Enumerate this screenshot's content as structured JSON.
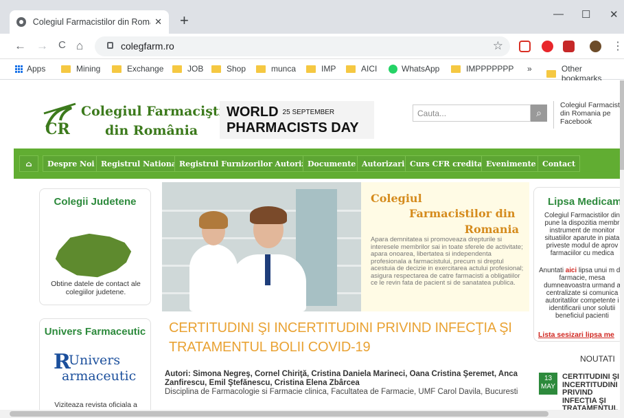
{
  "browser": {
    "tab_title": "Colegiul Farmacistilor din Romania",
    "tab_close": "✕",
    "new_tab": "+",
    "url": "colegfarm.ro",
    "controls": {
      "minimize": "—",
      "maximize": "☐",
      "close": "✕"
    },
    "nav": {
      "back": "←",
      "forward": "→",
      "reload": "C",
      "home": "⌂"
    },
    "menu": "⋮",
    "star": "☆",
    "bookmarks": [
      "Apps",
      "Mining",
      "Exchange",
      "JOB",
      "Shop",
      "munca",
      "IMP",
      "AICI",
      "WhatsApp",
      "IMPPPPPPP"
    ],
    "bookmarks_more": "»",
    "other_bookmarks": "Other bookmarks"
  },
  "header": {
    "logo_line1": "Colegiul Farmaciştilor",
    "logo_line2": "din România",
    "banner_title": "WORLD",
    "banner_date": "25 SEPTEMBER",
    "banner_sub": "PHARMACISTS DAY",
    "search_placeholder": "Cauta...",
    "facebook_text": "Colegiul Farmacisti din Romania pe Facebook"
  },
  "menu": {
    "home_icon": "⌂",
    "items": [
      "Despre Noi",
      "Registrul National",
      "Registrul Furnizorilor Autorizati",
      "Documente",
      "Autorizari",
      "Curs CFR creditat",
      "Evenimente",
      "Contact"
    ]
  },
  "left": {
    "colegii_title": "Colegii Judetene",
    "colegii_text": "Obtine datele de contact ale colegiilor judetene.",
    "univers_title": "Univers Farmaceutic",
    "univers_logo_1": "Univers",
    "univers_logo_2": "armaceutic",
    "univers_text": "Viziteaza revista oficiala a"
  },
  "promo": {
    "line1": "Colegiul",
    "line2": "Farmacistilor din",
    "line3": "Romania",
    "text": "Apara demnitatea si promoveaza drepturile si interesele membrilor sai in toate sferele de activitate; apara onoarea, libertatea si independenta profesionala a farmacistului, precum si dreptul acestuia de decizie in exercitarea actului profesional; asigura respectarea de catre farmacisti a obligatiilor ce le revin fata de pacient si de sanatatea publica."
  },
  "article": {
    "title": "CERTITUDINI ŞI INCERTITUDINI PRIVIND INFECŢIA ŞI TRATAMENTUL BOLII COVID-19",
    "authors": "Autori: Simona Negreş, Cornel Chiriţă, Cristina Daniela Marineci, Oana Cristina Şeremet, Anca Zanfirescu, Emil Ştefănescu, Cristina Elena Zbârcea",
    "dept": "Disciplina de Farmacologie si Farmacie clinica, Facultatea de Farmacie, UMF Carol Davila, Bucuresti"
  },
  "right": {
    "title": "Lipsa Medicam",
    "text1": "Colegiul Farmacistilor din pune la dispozitia membr instrument de monitor situatiilor aparute in piata priveste modul de aprov farmaciilor cu medica",
    "text2_pre": "Anuntati ",
    "text2_link": "aici",
    "text2_post": " lipsa unui m din farmacie, mesa dumneavoastra urmand a centralizate si comunica autoritatilor competente i identificarii unor solutii beneficiul pacienti",
    "link": "Lista sesizari lipsa me",
    "news_label": "NOUTATI",
    "news_day": "13",
    "news_month": "MAY",
    "news_title": "CERTITUDINI ŞI INCERTITUDINI PRIVIND INFECŢIA ŞI TRATAMENTUL"
  }
}
